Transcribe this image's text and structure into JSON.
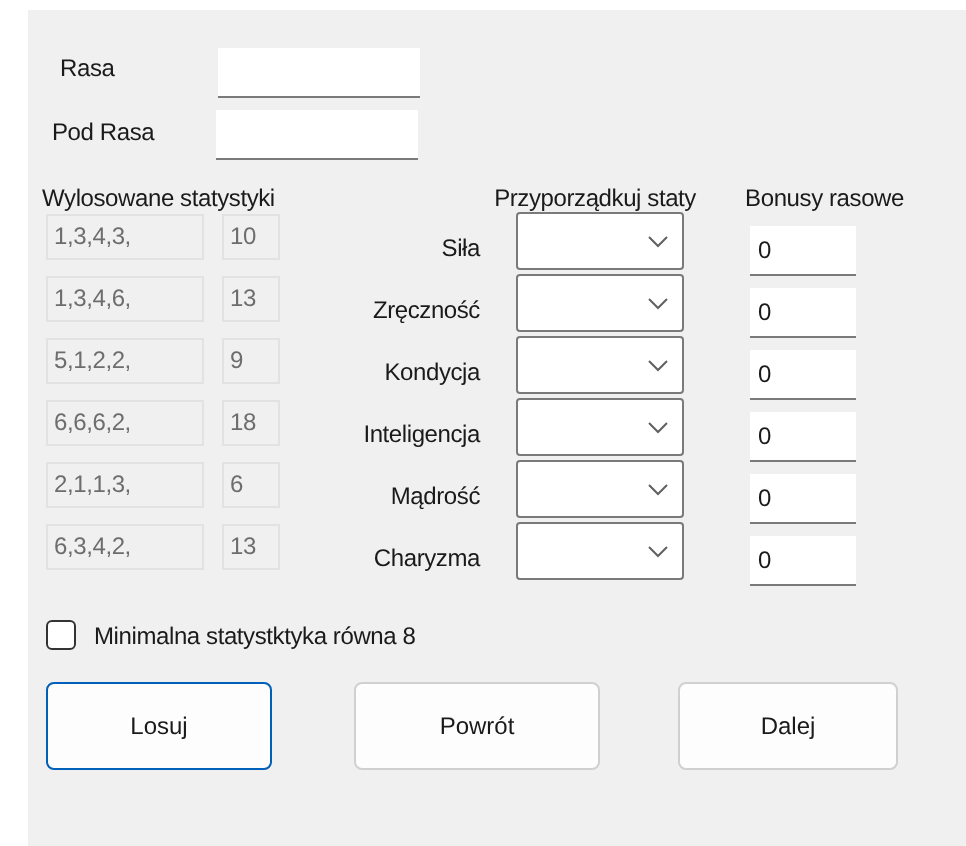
{
  "race_label": "Rasa",
  "subrace_label": "Pod Rasa",
  "rolled_header": "Wylosowane statystyki",
  "assign_header": "Przyporządkuj staty",
  "bonus_header": "Bonusy rasowe",
  "rolls": [
    {
      "dice": "1,3,4,3,",
      "sum": "10"
    },
    {
      "dice": "1,3,4,6,",
      "sum": "13"
    },
    {
      "dice": "5,1,2,2,",
      "sum": "9"
    },
    {
      "dice": "6,6,6,2,",
      "sum": "18"
    },
    {
      "dice": "2,1,1,3,",
      "sum": "6"
    },
    {
      "dice": "6,3,4,2,",
      "sum": "13"
    }
  ],
  "stats": [
    {
      "label": "Siła",
      "bonus": "0"
    },
    {
      "label": "Zręczność",
      "bonus": "0"
    },
    {
      "label": "Kondycja",
      "bonus": "0"
    },
    {
      "label": "Inteligencja",
      "bonus": "0"
    },
    {
      "label": "Mądrość",
      "bonus": "0"
    },
    {
      "label": "Charyzma",
      "bonus": "0"
    }
  ],
  "min_stat": {
    "label": "Minimalna statystktyka równa 8",
    "checked": false
  },
  "buttons": [
    {
      "label": "Losuj",
      "focused": true
    },
    {
      "label": "Powrót",
      "focused": false
    },
    {
      "label": "Dalej",
      "focused": false
    }
  ]
}
